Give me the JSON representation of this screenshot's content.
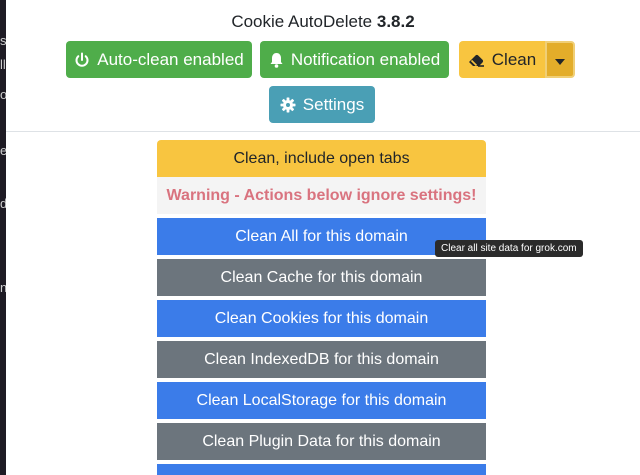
{
  "app": {
    "name": "Cookie AutoDelete",
    "version": "3.8.2"
  },
  "toolbar": {
    "auto_clean_label": "Auto-clean enabled",
    "notification_label": "Notification enabled",
    "clean_label": "Clean",
    "settings_label": "Settings"
  },
  "menu": {
    "items": [
      {
        "label": "Clean, include open tabs"
      },
      {
        "label": "Warning - Actions below ignore settings!"
      },
      {
        "label": "Clean All for this domain"
      },
      {
        "label": "Clean Cache for this domain"
      },
      {
        "label": "Clean Cookies for this domain"
      },
      {
        "label": "Clean IndexedDB for this domain"
      },
      {
        "label": "Clean LocalStorage for this domain"
      },
      {
        "label": "Clean Plugin Data for this domain"
      }
    ]
  },
  "tooltip": {
    "text": "Clear all site data for grok.com"
  },
  "background": {
    "fragments": [
      "st",
      "ll",
      "o",
      "e",
      "d",
      "n"
    ]
  },
  "colors": {
    "green": "#4fad4a",
    "teal": "#4a9fb5",
    "yellow": "#f8c540",
    "blue": "#3b7ce9",
    "gray": "#6c757d",
    "warning_text": "#d9737f"
  },
  "icons": {
    "auto_clean": "power-icon",
    "notification": "bell-icon",
    "clean": "eraser-icon",
    "dropdown": "caret-down-icon",
    "settings": "gear-icon"
  }
}
